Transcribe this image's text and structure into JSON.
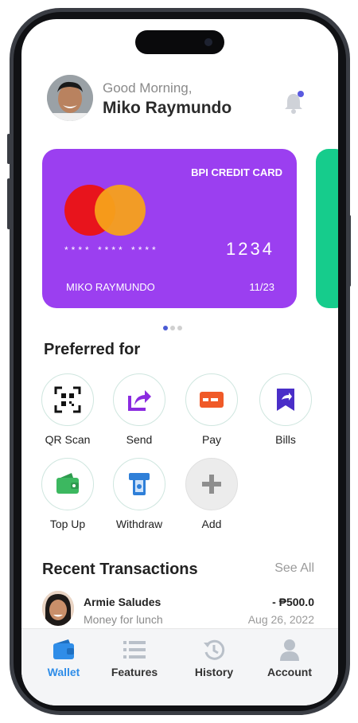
{
  "header": {
    "greeting": "Good Morning,",
    "user_name": "Miko Raymundo"
  },
  "card": {
    "title": "BPI CREDIT CARD",
    "masked_number": "**** **** ****",
    "last_four": "1234",
    "holder_name": "MIKO RAYMUNDO",
    "expiry": "11/23",
    "brand": "Mastercard"
  },
  "preferred": {
    "title": "Preferred for",
    "actions": [
      {
        "label": "QR Scan",
        "icon": "qr-scan-icon"
      },
      {
        "label": "Send",
        "icon": "send-icon"
      },
      {
        "label": "Pay",
        "icon": "pay-icon"
      },
      {
        "label": "Bills",
        "icon": "bills-icon"
      },
      {
        "label": "Top Up",
        "icon": "top-up-icon"
      },
      {
        "label": "Withdraw",
        "icon": "withdraw-icon"
      },
      {
        "label": "Add",
        "icon": "plus-icon"
      }
    ]
  },
  "recent": {
    "title": "Recent Transactions",
    "see_all": "See All",
    "transactions": [
      {
        "name": "Armie Saludes",
        "note": "Money for lunch",
        "amount": "- ₱500.0",
        "date": "Aug 26, 2022"
      }
    ]
  },
  "tabbar": {
    "tabs": [
      {
        "label": "Wallet",
        "active": true
      },
      {
        "label": "Features",
        "active": false
      },
      {
        "label": "History",
        "active": false
      },
      {
        "label": "Account",
        "active": false
      }
    ]
  },
  "colors": {
    "card_purple": "#9b3ff0",
    "card_green": "#16cc8c",
    "accent_blue": "#2f8de8",
    "mastercard_red": "#e8141c",
    "mastercard_orange": "#f7a11a"
  }
}
